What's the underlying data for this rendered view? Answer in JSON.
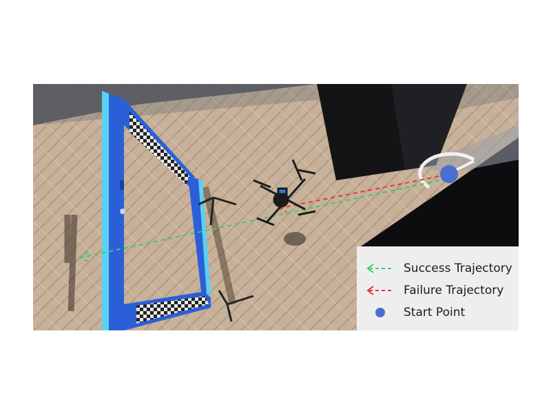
{
  "legend": {
    "success": {
      "label": "Success Trajectory",
      "color": "#3ec96b"
    },
    "failure": {
      "label": "Failure Trajectory",
      "color": "#e53535"
    },
    "start": {
      "label": "Start Point",
      "color": "#4a6fd1"
    }
  },
  "scene": {
    "floor_color": "#c9b39c",
    "wall_color": "#1e1e22",
    "gate_color": "#2a5fd8",
    "gate_edge_color": "#5ad1f2"
  }
}
